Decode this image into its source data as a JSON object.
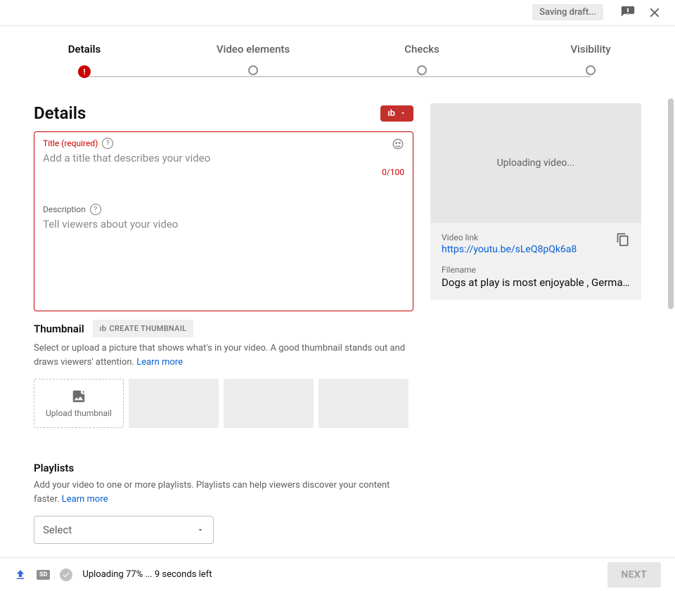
{
  "topbar": {
    "saving_label": "Saving draft..."
  },
  "stepper": {
    "steps": [
      "Details",
      "Video elements",
      "Checks",
      "Visibility"
    ]
  },
  "details": {
    "heading": "Details",
    "ib_badge": "ıb",
    "title_label": "Title (required)",
    "title_placeholder": "Add a title that describes your video",
    "title_count": "0/100",
    "desc_label": "Description",
    "desc_placeholder": "Tell viewers about your video"
  },
  "thumbnail": {
    "heading": "Thumbnail",
    "create_label": "CREATE THUMBNAIL",
    "subtext": "Select or upload a picture that shows what's in your video. A good thumbnail stands out and draws viewers' attention.",
    "learn_more": "Learn more",
    "upload_label": "Upload thumbnail"
  },
  "playlists": {
    "heading": "Playlists",
    "subtext": "Add your video to one or more playlists. Playlists can help viewers discover your content faster.",
    "learn_more": "Learn more",
    "select_label": "Select"
  },
  "preview": {
    "uploading_label": "Uploading video...",
    "link_label": "Video link",
    "link_value": "https://youtu.be/sLeQ8pQk6a8",
    "filename_label": "Filename",
    "filename_value": "Dogs at play is most enjoyable , German…"
  },
  "footer": {
    "hd_label": "SD",
    "status": "Uploading 77% ... 9 seconds left",
    "next_label": "NEXT"
  }
}
